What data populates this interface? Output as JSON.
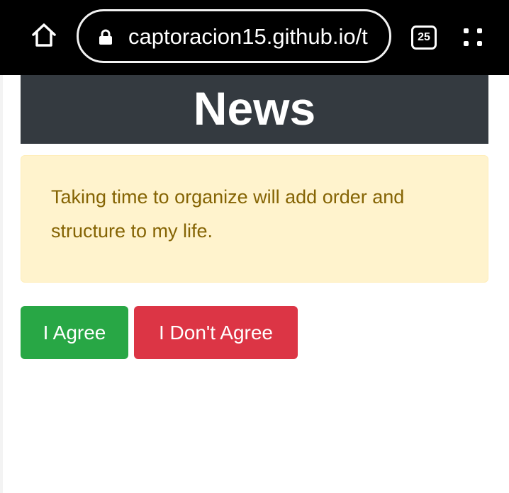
{
  "browser": {
    "home_icon": "home-icon",
    "lock_icon": "lock-icon",
    "url": "captoracion15.github.io/t",
    "tab_count": "25",
    "menu_icon": "more-vert-icon"
  },
  "page": {
    "header_title": "News",
    "alert_text": "Taking time to organize will add order and structure to my life.",
    "agree_label": "I Agree",
    "disagree_label": "I Don't Agree"
  },
  "colors": {
    "header_bg": "#343a40",
    "alert_bg": "#fff3cd",
    "alert_text": "#856404",
    "agree_bg": "#28a745",
    "disagree_bg": "#dc3545"
  }
}
